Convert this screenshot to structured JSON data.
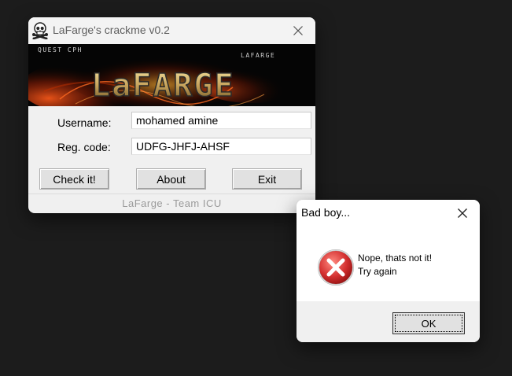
{
  "main_window": {
    "title": "LaFarge's crackme v0.2",
    "banner": {
      "small_left": "QUEST CPH",
      "small_right": "LAFARGE",
      "logo_text": "LaFARGE"
    },
    "username_label": "Username:",
    "username_value": "mohamed amine",
    "regcode_label": "Reg. code:",
    "regcode_value": "UDFG-JHFJ-AHSF",
    "buttons": {
      "check": "Check it!",
      "about": "About",
      "exit": "Exit"
    },
    "footer": "LaFarge - Team ICU",
    "icon": "skull-crossbones-icon"
  },
  "dialog": {
    "title": "Bad boy...",
    "message_line1": "Nope, thats not it!",
    "message_line2": "Try again",
    "ok_label": "OK",
    "icon": "error-icon"
  },
  "colors": {
    "desktop": "#1c1c1c",
    "window": "#f0f0f0",
    "error_red": "#c42b1c"
  }
}
